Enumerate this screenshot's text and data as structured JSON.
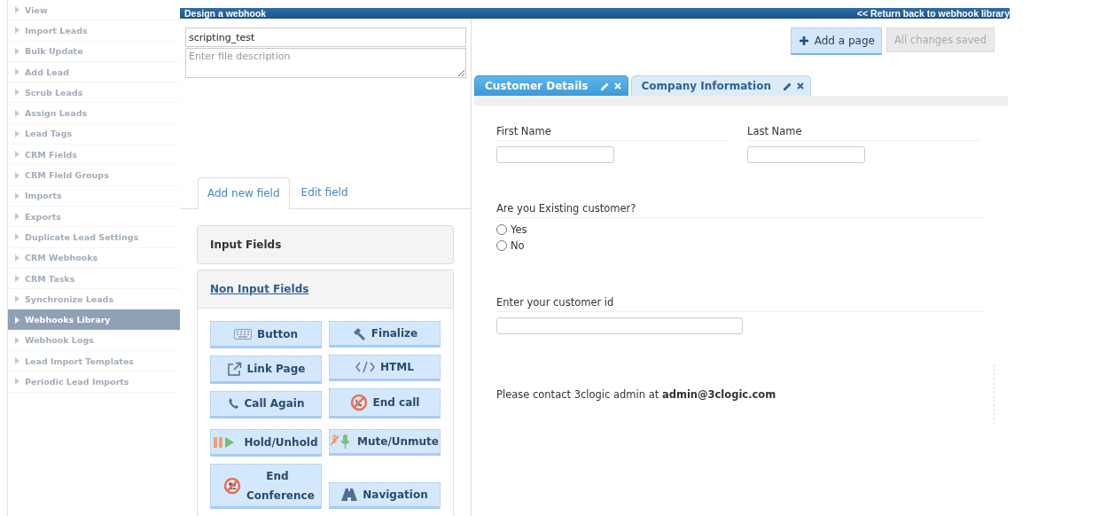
{
  "sidebar": {
    "items": [
      {
        "label": "View",
        "selected": false
      },
      {
        "label": "Import Leads",
        "selected": false
      },
      {
        "label": "Bulk Update",
        "selected": false
      },
      {
        "label": "Add Lead",
        "selected": false
      },
      {
        "label": "Scrub Leads",
        "selected": false
      },
      {
        "label": "Assign Leads",
        "selected": false
      },
      {
        "label": "Lead Tags",
        "selected": false
      },
      {
        "label": "CRM Fields",
        "selected": false
      },
      {
        "label": "CRM Field Groups",
        "selected": false
      },
      {
        "label": "Imports",
        "selected": false
      },
      {
        "label": "Exports",
        "selected": false
      },
      {
        "label": "Duplicate Lead Settings",
        "selected": false
      },
      {
        "label": "CRM Webhooks",
        "selected": false
      },
      {
        "label": "CRM Tasks",
        "selected": false
      },
      {
        "label": "Synchronize Leads",
        "selected": false
      },
      {
        "label": "Webhooks Library",
        "selected": true
      },
      {
        "label": "Webhook Logs",
        "selected": false
      },
      {
        "label": "Lead Import Templates",
        "selected": false
      },
      {
        "label": "Periodic Lead Imports",
        "selected": false
      }
    ]
  },
  "header": {
    "title": "Design a webhook",
    "return_link": "<< Return back to webhook library"
  },
  "file": {
    "name": "scripting_test",
    "description_placeholder": "Enter file description"
  },
  "field_tabs": [
    {
      "label": "Add new field",
      "selected": true
    },
    {
      "label": "Edit field",
      "selected": false
    }
  ],
  "sections": [
    {
      "title": "Input Fields",
      "expanded": false
    },
    {
      "title": "Non Input Fields",
      "expanded": true,
      "tools": [
        {
          "label": "Button",
          "kind": "keyboard"
        },
        {
          "label": "Finalize",
          "kind": "gavel"
        },
        {
          "label": "Link Page",
          "kind": "external"
        },
        {
          "label": "HTML",
          "kind": "code"
        },
        {
          "label": "Call Again",
          "kind": "phone"
        },
        {
          "label": "End call",
          "kind": "hangup"
        },
        {
          "label": "Hold/Unhold",
          "kind": "hold"
        },
        {
          "label": "Mute/Unmute",
          "kind": "mute"
        },
        {
          "label": "End Conference",
          "kind": "endconf"
        },
        {
          "label": "Navigation",
          "kind": "road"
        }
      ]
    }
  ],
  "toolbar": {
    "add_page": "Add a page",
    "save_status": {
      "label": "All changes saved",
      "disabled": true
    }
  },
  "pages": [
    {
      "label": "Customer Details",
      "selected": true
    },
    {
      "label": "Company Information",
      "selected": false
    }
  ],
  "form": [
    {
      "kind": "pair",
      "fields": [
        {
          "label": "First Name"
        },
        {
          "label": "Last Name"
        }
      ]
    },
    {
      "kind": "radio",
      "label": "Are you Existing customer?",
      "options": [
        {
          "label": "Yes",
          "selected": false
        },
        {
          "label": "No",
          "selected": false
        }
      ]
    },
    {
      "kind": "text",
      "label": "Enter your customer id"
    },
    {
      "kind": "note",
      "text": "Please contact 3clogic admin at **admin@3clogic.com**"
    }
  ]
}
